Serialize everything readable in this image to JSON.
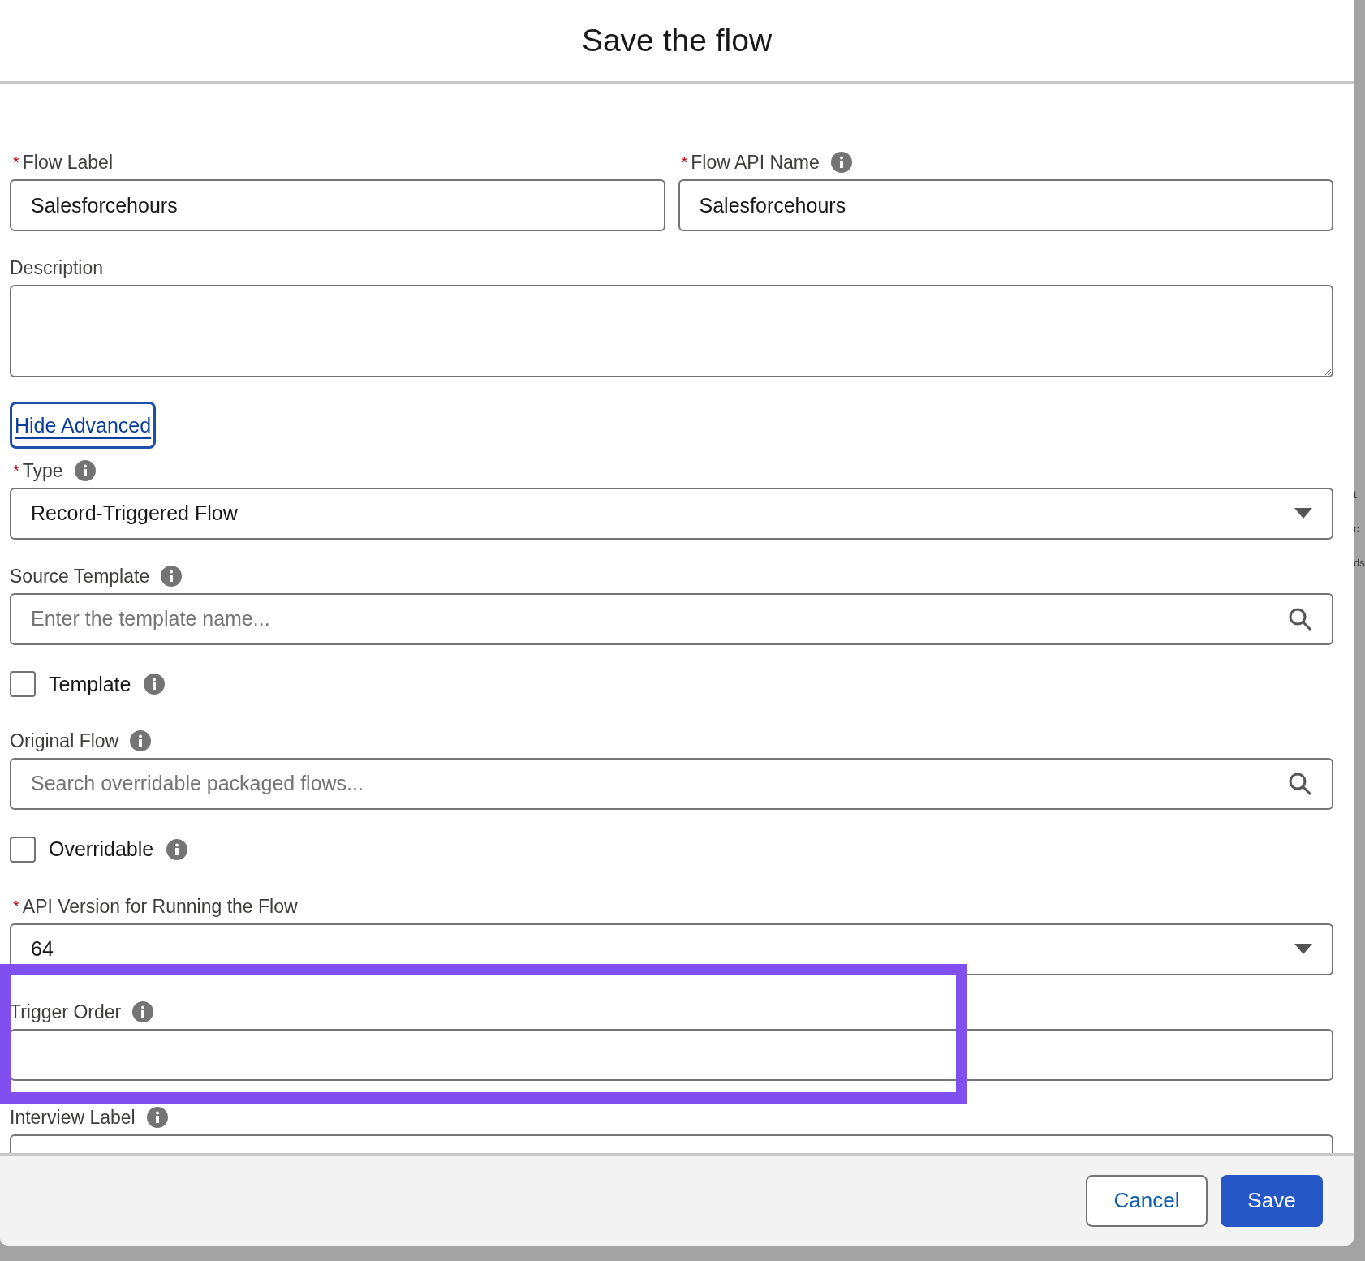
{
  "dialog": {
    "title": "Save the flow"
  },
  "fields": [
    {
      "kind": "text",
      "label": "Flow Label",
      "marker": "*",
      "info": false,
      "value": "Salesforcehours",
      "half": true
    },
    {
      "kind": "text",
      "label": "Flow API Name",
      "marker": "*",
      "info": true,
      "value": "Salesforcehours",
      "half": true
    },
    {
      "kind": "textarea",
      "label": "Description",
      "info": false
    },
    {
      "kind": "link",
      "label": "Hide Advanced",
      "focused": true
    },
    {
      "kind": "select",
      "label": "Type",
      "marker": "*",
      "info": true,
      "value": "Record-Triggered Flow"
    },
    {
      "kind": "lookup",
      "label": "Source Template",
      "info": true,
      "placeholder": "Enter the template name..."
    },
    {
      "kind": "checkbox",
      "label": "Template",
      "info": true,
      "checked": false
    },
    {
      "kind": "lookup",
      "label": "Original Flow",
      "info": true,
      "placeholder": "Search overridable packaged flows..."
    },
    {
      "kind": "checkbox",
      "label": "Overridable",
      "info": true,
      "checked": false
    },
    {
      "kind": "select",
      "label": "API Version for Running the Flow",
      "marker": "*",
      "info": false,
      "value": "64"
    },
    {
      "kind": "text",
      "label": "Trigger Order",
      "info": true,
      "highlighted": true
    },
    {
      "kind": "text",
      "label": "Interview Label",
      "info": true
    }
  ],
  "footer": {
    "buttons": [
      {
        "label": "Cancel",
        "kind": "neutral"
      },
      {
        "label": "Save",
        "kind": "brand"
      }
    ]
  },
  "background_text": [
    "t",
    "c",
    "ds"
  ]
}
